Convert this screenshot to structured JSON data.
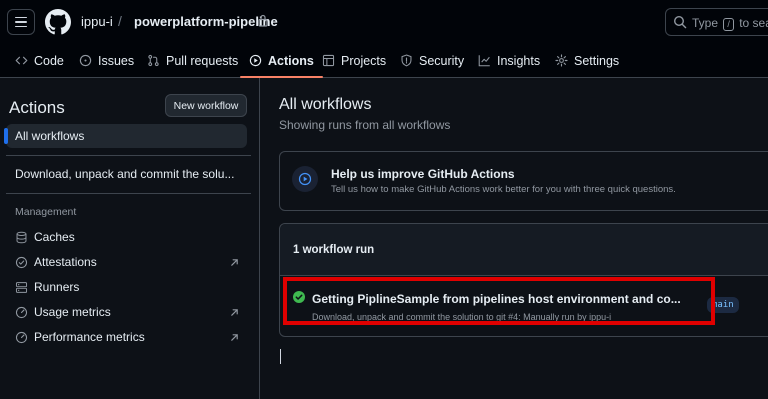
{
  "header": {
    "owner": "ippu-i",
    "separator": "/",
    "repo": "powerplatform-pipeline",
    "search": {
      "prefix": "Type",
      "key": "/",
      "suffix": "to search"
    }
  },
  "nav": {
    "tabs": [
      {
        "label": "Code",
        "icon": "code-icon"
      },
      {
        "label": "Issues",
        "icon": "issue-icon"
      },
      {
        "label": "Pull requests",
        "icon": "pull-request-icon"
      },
      {
        "label": "Actions",
        "icon": "play-icon",
        "active": true
      },
      {
        "label": "Projects",
        "icon": "table-icon"
      },
      {
        "label": "Security",
        "icon": "shield-icon"
      },
      {
        "label": "Insights",
        "icon": "graph-icon"
      },
      {
        "label": "Settings",
        "icon": "gear-icon"
      }
    ]
  },
  "sidebar": {
    "title": "Actions",
    "new_workflow": "New workflow",
    "all_workflows": "All workflows",
    "workflow_item": "Download, unpack and commit the solu...",
    "management_heading": "Management",
    "management_items": [
      {
        "label": "Caches",
        "icon": "cache-icon"
      },
      {
        "label": "Attestations",
        "icon": "verified-icon",
        "external": true
      },
      {
        "label": "Runners",
        "icon": "server-icon"
      },
      {
        "label": "Usage metrics",
        "icon": "meter-icon",
        "external": true
      },
      {
        "label": "Performance metrics",
        "icon": "meter-icon",
        "external": true
      }
    ]
  },
  "main": {
    "title": "All workflows",
    "subtitle": "Showing runs from all workflows",
    "help": {
      "title": "Help us improve GitHub Actions",
      "subtitle": "Tell us how to make GitHub Actions work better for you with three quick questions."
    },
    "runs": {
      "count_label": "1 workflow run",
      "items": [
        {
          "status": "success",
          "title": "Getting PiplineSample from pipelines host environment and co...",
          "subtitle": "Download, unpack and commit the solution to git #4: Manually run by ippu-i",
          "branch": "main"
        }
      ]
    }
  },
  "colors": {
    "background": "#0d1117",
    "header_bg": "#010409",
    "border": "#3d444d",
    "active_tab_underline": "#f78166",
    "success": "#3fb950",
    "highlight": "#e00000",
    "link_accent": "#1f6feb"
  }
}
